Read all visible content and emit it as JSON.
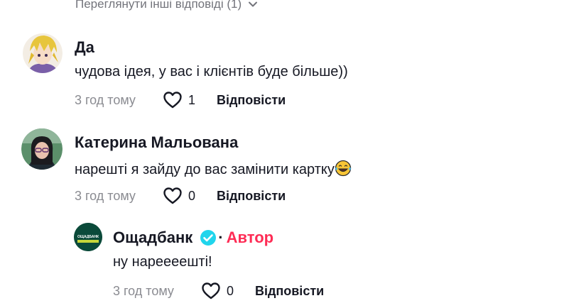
{
  "view_more": {
    "label": "Переглянути інші відповіді (1)"
  },
  "comments": [
    {
      "name": "Да",
      "text": "чудова ідея, у вас і клієнтів буде більше))",
      "time": "3 год тому",
      "likes": "1",
      "reply": "Відповісти"
    },
    {
      "name": "Катерина Мальована",
      "text": "нарешті я зайду до вас замінити картку",
      "emoji": "face-with-tears-of-joy",
      "time": "3 год тому",
      "likes": "0",
      "reply": "Відповісти"
    }
  ],
  "reply_comment": {
    "name": "Ощадбанк",
    "author_badge": "Автор",
    "dot": "·",
    "logo_text": "ОЩАДБАНК",
    "text": "ну нареееешті!",
    "time": "3 год тому",
    "likes": "0",
    "reply": "Відповісти"
  },
  "colors": {
    "author": "#fe2c55",
    "verified": "#20d5ec",
    "muted": "#8a8b91",
    "brand_green": "#0b4a3a"
  }
}
